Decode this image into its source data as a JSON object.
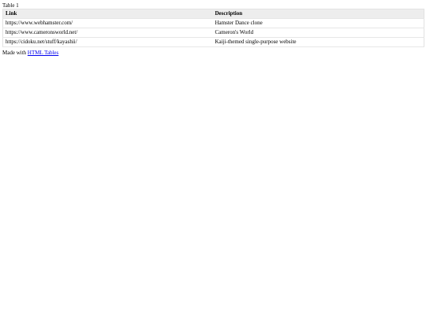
{
  "table": {
    "caption": "Table 1",
    "headers": [
      "Link",
      "Description"
    ],
    "rows": [
      [
        "https://www.webhamster.com/",
        "Hamster Dance clone"
      ],
      [
        "https://www.cameronsworld.net/",
        "Cameron's World"
      ],
      [
        "https://cidoku.net/stuff/kayashii/",
        "Kaiji-themed single-purpose website"
      ]
    ]
  },
  "footer": {
    "prefix": "Made with ",
    "link_text": "HTML Tables"
  },
  "colors": {
    "header_bg": "#ededed",
    "link": "#0000ee"
  }
}
